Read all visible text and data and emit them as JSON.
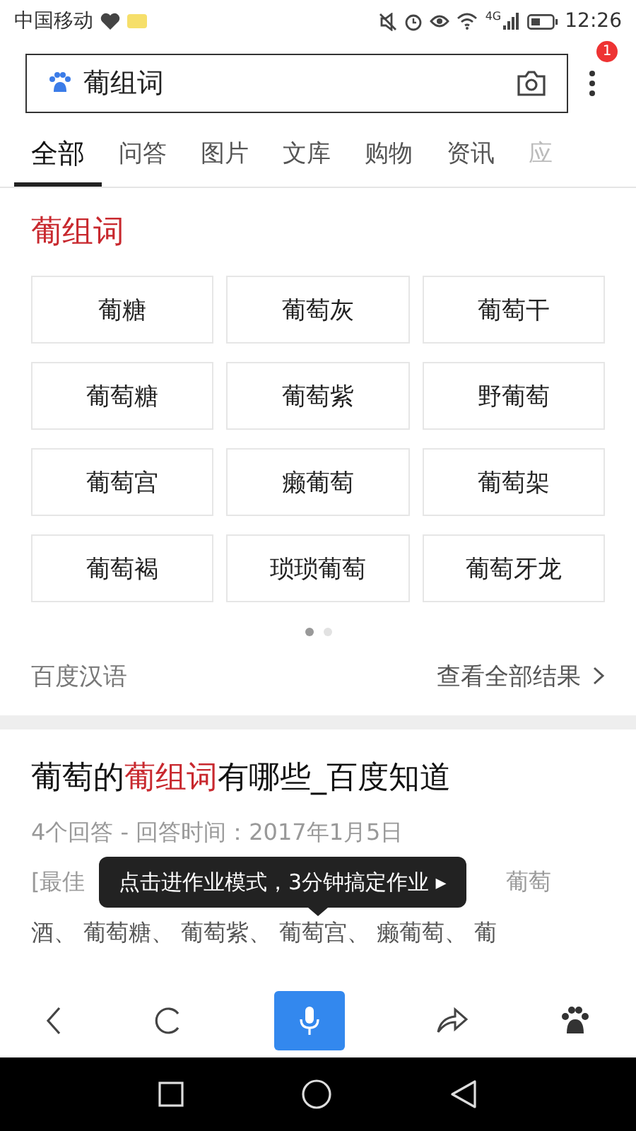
{
  "status_bar": {
    "carrier": "中国移动",
    "network": "4G",
    "time": "12:26"
  },
  "search": {
    "value": "葡组词",
    "menu_badge": "1"
  },
  "tabs": [
    {
      "label": "全部",
      "selected": true
    },
    {
      "label": "问答",
      "selected": false
    },
    {
      "label": "图片",
      "selected": false
    },
    {
      "label": "文库",
      "selected": false
    },
    {
      "label": "购物",
      "selected": false
    },
    {
      "label": "资讯",
      "selected": false
    },
    {
      "label": "应",
      "selected": false
    }
  ],
  "dictionary_card": {
    "title": "葡组词",
    "words": [
      "葡糖",
      "葡萄灰",
      "葡萄干",
      "葡萄糖",
      "葡萄紫",
      "野葡萄",
      "葡萄宫",
      "癞葡萄",
      "葡萄架",
      "葡萄褐",
      "琐琐葡萄",
      "葡萄牙龙"
    ],
    "pages": [
      {
        "selected": true
      },
      {
        "selected": false
      }
    ],
    "source": "百度汉语",
    "more_link": "查看全部结果"
  },
  "result": {
    "title": "葡萄的**葡组词**有哪些_百度知道",
    "meta": "4个回答 - 回答时间：2017年1月5日",
    "snippet_start": "[最佳",
    "snippet_line_end": "葡萄",
    "snippet_line_2": "酒、 葡萄糖、 葡萄紫、 葡萄宫、 癞葡萄、 葡"
  },
  "tooltip": "点击进作业模式，3分钟搞定作业 ▸"
}
